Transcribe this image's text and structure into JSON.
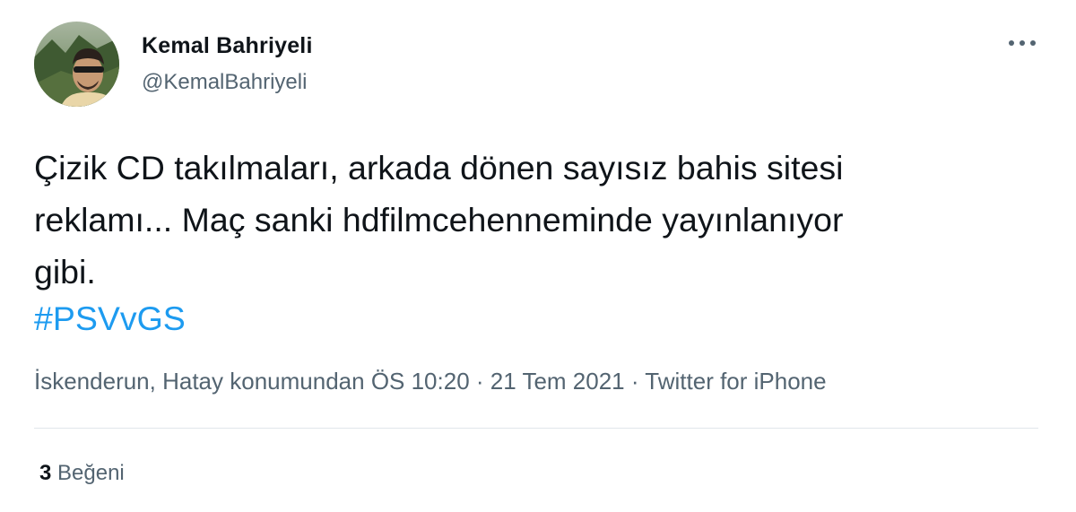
{
  "author": {
    "display_name": "Kemal Bahriyeli",
    "handle": "@KemalBahriyeli"
  },
  "tweet": {
    "text": "Çizik CD takılmaları, arkada dönen sayısız bahis sitesi\nreklamı... Maç sanki hdfilmcehenneminde yayınlanıyor\ngibi.",
    "hashtag": "#PSVvGS"
  },
  "meta": {
    "location": "İskenderun, Hatay konumundan",
    "time": "ÖS 10:20",
    "separator": " · ",
    "date": "21 Tem 2021",
    "source": "Twitter for iPhone"
  },
  "engagement": {
    "likes_count": "3",
    "likes_label": "Beğeni"
  },
  "icons": {
    "more": "more-horizontal-icon",
    "avatar": "profile-photo"
  },
  "colors": {
    "link": "#1d9bf0",
    "secondary_text": "#536471",
    "primary_text": "#0f1419"
  }
}
